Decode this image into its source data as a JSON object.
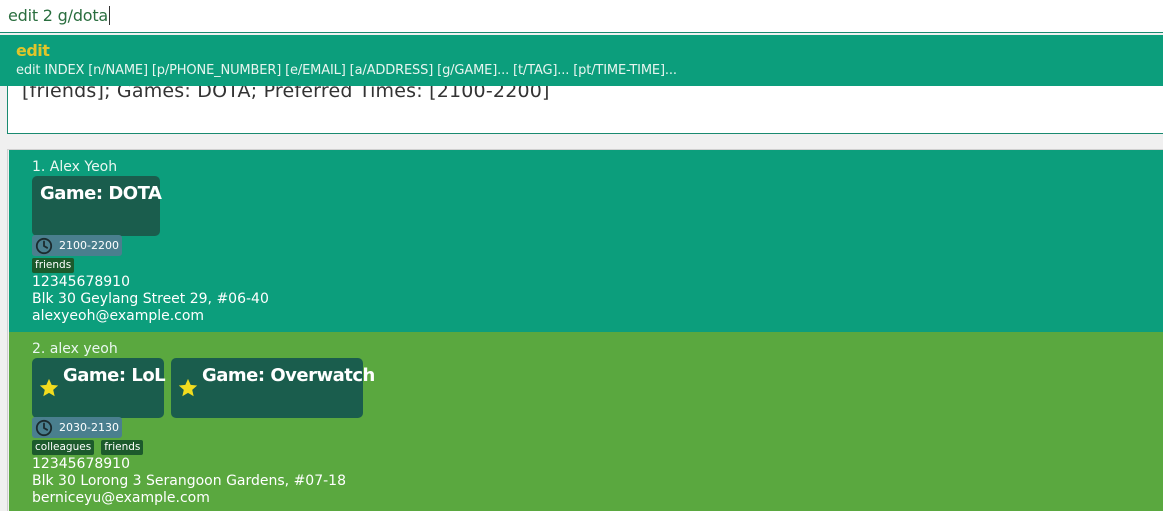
{
  "command_box": {
    "value": "edit 2 g/dota"
  },
  "suggestion": {
    "command": "edit",
    "usage": "edit INDEX [n/NAME] [p/PHONE_NUMBER] [e/EMAIL] [a/ADDRESS] [g/GAME]... [t/TAG]... [pt/TIME-TIME]..."
  },
  "result_display": {
    "visible_text": "[friends]; Games: DOTA; Preferred Times: [2100-2200]"
  },
  "colors": {
    "accent": "#0c9e7c",
    "card_highlight": "#5aa83f",
    "game_badge": "#1a5d4d",
    "time_badge": "#4a7f8e",
    "tag": "#1c5a2c",
    "command_name": "#e0c52a"
  },
  "persons": [
    {
      "index_name": "1. Alex Yeoh",
      "games": [
        {
          "label": "Game: DOTA",
          "favourite": false
        }
      ],
      "time": "2100-2200",
      "tags": [
        "friends"
      ],
      "phone": "12345678910",
      "address": "Blk 30 Geylang Street 29, #06-40",
      "email": "alexyeoh@example.com"
    },
    {
      "index_name": "2. alex yeoh",
      "games": [
        {
          "label": "Game: LoL",
          "favourite": true
        },
        {
          "label": "Game: Overwatch",
          "favourite": true
        }
      ],
      "time": "2030-2130",
      "tags": [
        "colleagues",
        "friends"
      ],
      "phone": "12345678910",
      "address": "Blk 30 Lorong 3 Serangoon Gardens, #07-18",
      "email": "berniceyu@example.com"
    }
  ],
  "icons": {
    "favourite": "star-icon",
    "time": "clock-icon"
  }
}
